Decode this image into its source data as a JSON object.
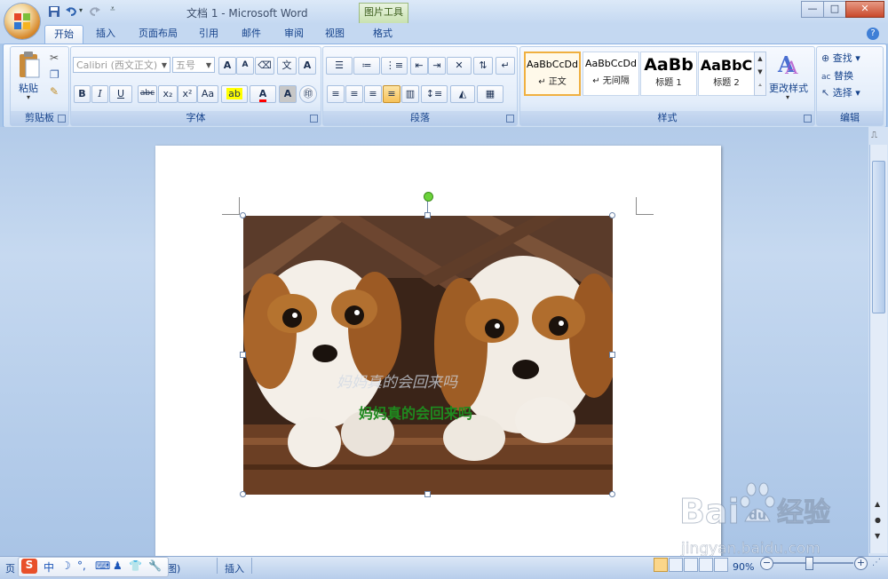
{
  "window": {
    "title": "文档 1 - Microsoft Word",
    "context_tab_group": "图片工具",
    "controls": {
      "minimize": "—",
      "maximize": "□",
      "close": "✕"
    }
  },
  "tabs": [
    "开始",
    "插入",
    "页面布局",
    "引用",
    "邮件",
    "审阅",
    "视图",
    "格式"
  ],
  "active_tab": "开始",
  "clipboard": {
    "paste_label": "粘贴",
    "group_label": "剪贴板"
  },
  "font": {
    "font_name": "Calibri (西文正文)",
    "font_size": "五号",
    "group_label": "字体",
    "buttons": {
      "grow": "A",
      "shrink": "A",
      "bold": "B",
      "italic": "I",
      "underline": "U",
      "strike": "abc",
      "sub": "x₂",
      "sup": "x²",
      "case": "Aa",
      "char_border": "A"
    }
  },
  "paragraph": {
    "group_label": "段落"
  },
  "styles": {
    "group_label": "样式",
    "items": [
      {
        "sample": "AaBbCcDd",
        "name": "↵ 正文"
      },
      {
        "sample": "AaBbCcDd",
        "name": "↵ 无间隔"
      },
      {
        "sample": "AaBb",
        "name": "标题 1"
      },
      {
        "sample": "AaBbC",
        "name": "标题 2"
      }
    ],
    "change_styles_label": "更改样式"
  },
  "editing": {
    "group_label": "编辑",
    "find_label": "查找",
    "replace_label": "替换",
    "select_label": "选择"
  },
  "document": {
    "image_text_1": "妈妈真的会回来吗",
    "image_text_2": "妈妈真的会回来吗"
  },
  "statusbar": {
    "page_prefix": "页",
    "status_fragment": "图)",
    "insert_mode": "插入",
    "zoom": "90%",
    "zoom_level": 0.9
  },
  "ime": {
    "labels": [
      "S",
      "中",
      "☽",
      "°,",
      "⌨",
      "♟",
      "👕",
      "🔧"
    ]
  },
  "watermark": {
    "brand": "Bai",
    "paw": "du",
    "cn": "经验",
    "url": "jingyan.baidu.com"
  },
  "colors": {
    "highlight": "#ffff00",
    "font_color": "#ff0000",
    "brand_blue": "#2d6fd1",
    "selected_style": "#f0b040"
  }
}
